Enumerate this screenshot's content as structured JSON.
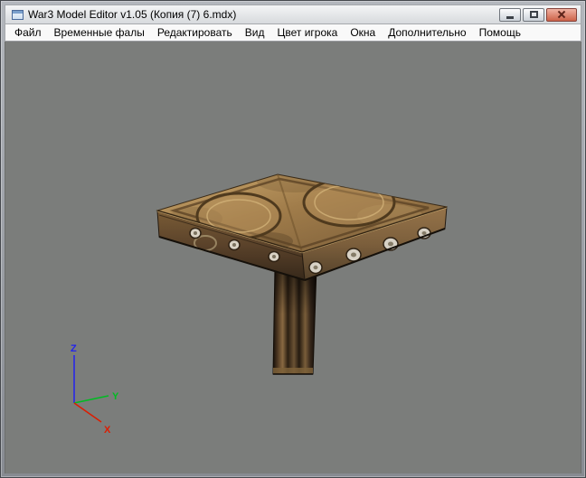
{
  "window": {
    "title": "War3 Model Editor v1.05 (Копия (7) 6.mdx)"
  },
  "menubar": {
    "items": [
      "Файл",
      "Временные фалы",
      "Редактировать",
      "Вид",
      "Цвет игрока",
      "Окна",
      "Дополнительно",
      "Помощь"
    ]
  },
  "viewport": {
    "background_color": "#7b7d7b",
    "model": "wooden square table with ornate carved top and single pedestal leg",
    "axes": {
      "x": {
        "label": "X",
        "color": "#dd1c00"
      },
      "y": {
        "label": "Y",
        "color": "#00bb22"
      },
      "z": {
        "label": "Z",
        "color": "#2222ee"
      }
    }
  }
}
